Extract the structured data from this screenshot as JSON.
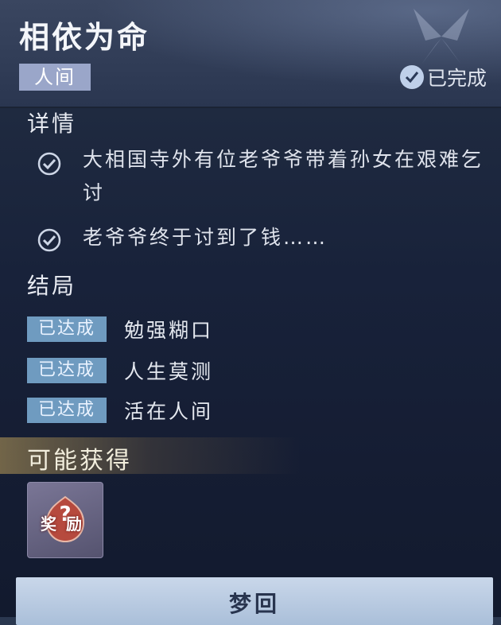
{
  "header": {
    "title": "相依为命",
    "tag": "人间",
    "status": "已完成"
  },
  "details": {
    "title": "详情",
    "items": [
      {
        "text": "大相国寺外有位老爷爷带着孙女在艰难乞讨",
        "checked": true
      },
      {
        "text": "老爷爷终于讨到了钱……",
        "checked": true
      }
    ]
  },
  "endings": {
    "title": "结局",
    "items": [
      {
        "badge": "已达成",
        "label": "勉强糊口"
      },
      {
        "badge": "已达成",
        "label": "人生莫测"
      },
      {
        "badge": "已达成",
        "label": "活在人间"
      }
    ]
  },
  "rewards": {
    "title": "可能获得",
    "item_label": "奖励",
    "item_icon": "mystery-reward-icon"
  },
  "action": {
    "label": "梦回"
  },
  "colors": {
    "badge": "#6f9bc0",
    "tag": "#9aa6c9",
    "button": "#bfd0e6"
  }
}
